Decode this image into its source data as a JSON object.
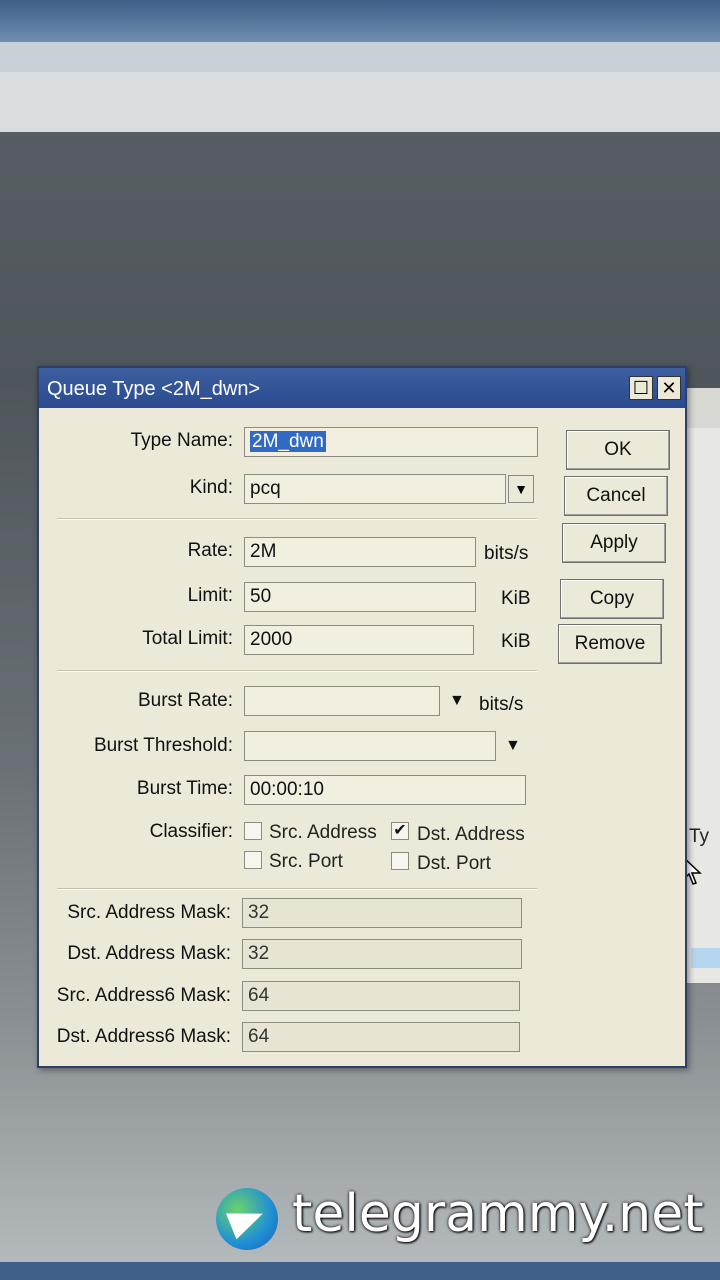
{
  "dialog": {
    "title": "Queue Type <2M_dwn>",
    "max_glyph": "☐",
    "close_glyph": "✕"
  },
  "fields": {
    "type_name": {
      "label": "Type Name:",
      "value": "2M_dwn"
    },
    "kind": {
      "label": "Kind:",
      "value": "pcq"
    },
    "rate": {
      "label": "Rate:",
      "value": "2M",
      "unit": "bits/s"
    },
    "limit": {
      "label": "Limit:",
      "value": "50",
      "unit": "KiB"
    },
    "total_limit": {
      "label": "Total Limit:",
      "value": "2000",
      "unit": "KiB"
    },
    "burst_rate": {
      "label": "Burst Rate:",
      "value": "",
      "unit": "bits/s"
    },
    "burst_threshold": {
      "label": "Burst Threshold:",
      "value": ""
    },
    "burst_time": {
      "label": "Burst Time:",
      "value": "00:00:10"
    },
    "src_address_mask": {
      "label": "Src. Address Mask:",
      "value": "32"
    },
    "dst_address_mask": {
      "label": "Dst. Address Mask:",
      "value": "32"
    },
    "src_address6_mask": {
      "label": "Src. Address6 Mask:",
      "value": "64"
    },
    "dst_address6_mask": {
      "label": "Dst. Address6 Mask:",
      "value": "64"
    }
  },
  "classifier": {
    "label": "Classifier:",
    "options": [
      {
        "label": "Src. Address",
        "checked": false
      },
      {
        "label": "Dst. Address",
        "checked": true
      },
      {
        "label": "Src. Port",
        "checked": false
      },
      {
        "label": "Dst. Port",
        "checked": false
      }
    ],
    "check_glyph": "✔"
  },
  "buttons": {
    "ok": "OK",
    "cancel": "Cancel",
    "apply": "Apply",
    "copy": "Copy",
    "remove": "Remove"
  },
  "background": {
    "partial_label": "Ty"
  },
  "watermark": {
    "text": "telegrammy.net"
  },
  "icons": {
    "dropdown": "▼"
  }
}
